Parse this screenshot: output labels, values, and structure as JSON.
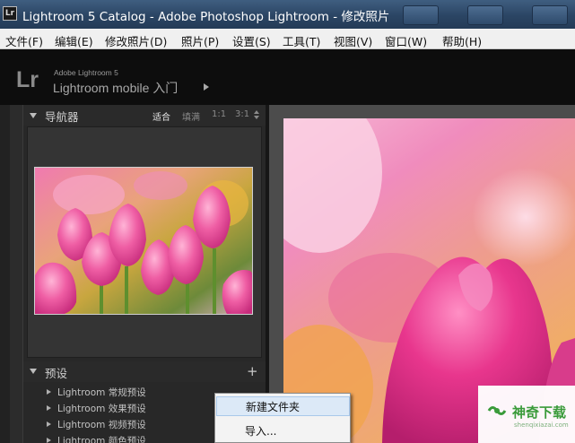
{
  "window": {
    "title": "Lightroom 5 Catalog - Adobe Photoshop Lightroom - 修改照片",
    "app_icon_text": "Lr"
  },
  "menu": {
    "items": [
      "文件(F)",
      "编辑(E)",
      "修改照片(D)",
      "照片(P)",
      "设置(S)",
      "工具(T)",
      "视图(V)",
      "窗口(W)",
      "帮助(H)"
    ]
  },
  "identity": {
    "logo": "Lr",
    "product": "Adobe Lightroom 5",
    "module_text": "Lightroom mobile 入门"
  },
  "navigator": {
    "title": "导航器",
    "zoom_options": [
      "适合",
      "填满",
      "1:1",
      "3:1"
    ],
    "active_zoom": "适合"
  },
  "presets": {
    "title": "预设",
    "add_label": "+",
    "items": [
      "Lightroom 常规预设",
      "Lightroom 效果预设",
      "Lightroom 视频预设",
      "Lightroom 颜色预设"
    ]
  },
  "context_menu": {
    "items": [
      "新建文件夹",
      "导入..."
    ],
    "highlighted_index": 0
  },
  "watermark": {
    "text": "神奇下载",
    "sub": "shenqixiazai.com"
  },
  "colors": {
    "titlebar": "#2b4564",
    "panel": "#282828",
    "highlight": "#dce9f7",
    "photo_pink": "#e8408f"
  }
}
